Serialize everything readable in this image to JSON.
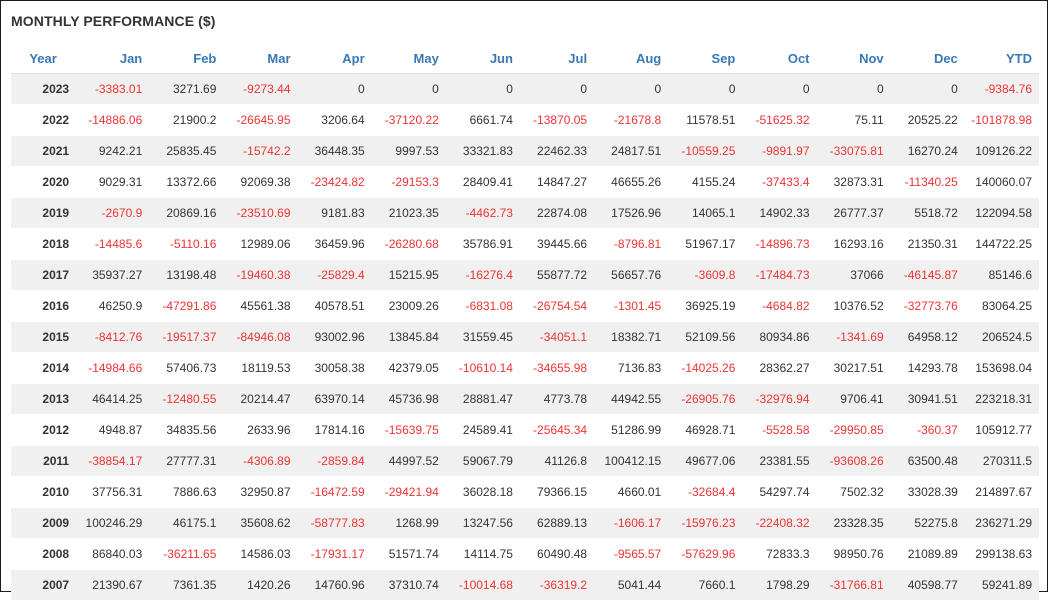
{
  "title": "MONTHLY PERFORMANCE ($)",
  "colors": {
    "header_text": "#3a78b5",
    "negative": "#ee3333",
    "positive": "#333333",
    "stripe": "#f0f0f0"
  },
  "table": {
    "columns": [
      "Year",
      "Jan",
      "Feb",
      "Mar",
      "Apr",
      "May",
      "Jun",
      "Jul",
      "Aug",
      "Sep",
      "Oct",
      "Nov",
      "Dec",
      "YTD"
    ],
    "rows": [
      [
        "2023",
        "-3383.01",
        "3271.69",
        "-9273.44",
        "0",
        "0",
        "0",
        "0",
        "0",
        "0",
        "0",
        "0",
        "0",
        "-9384.76"
      ],
      [
        "2022",
        "-14886.06",
        "21900.2",
        "-26645.95",
        "3206.64",
        "-37120.22",
        "6661.74",
        "-13870.05",
        "-21678.8",
        "11578.51",
        "-51625.32",
        "75.11",
        "20525.22",
        "-101878.98"
      ],
      [
        "2021",
        "9242.21",
        "25835.45",
        "-15742.2",
        "36448.35",
        "9997.53",
        "33321.83",
        "22462.33",
        "24817.51",
        "-10559.25",
        "-9891.97",
        "-33075.81",
        "16270.24",
        "109126.22"
      ],
      [
        "2020",
        "9029.31",
        "13372.66",
        "92069.38",
        "-23424.82",
        "-29153.3",
        "28409.41",
        "14847.27",
        "46655.26",
        "4155.24",
        "-37433.4",
        "32873.31",
        "-11340.25",
        "140060.07"
      ],
      [
        "2019",
        "-2670.9",
        "20869.16",
        "-23510.69",
        "9181.83",
        "21023.35",
        "-4462.73",
        "22874.08",
        "17526.96",
        "14065.1",
        "14902.33",
        "26777.37",
        "5518.72",
        "122094.58"
      ],
      [
        "2018",
        "-14485.6",
        "-5110.16",
        "12989.06",
        "36459.96",
        "-26280.68",
        "35786.91",
        "39445.66",
        "-8796.81",
        "51967.17",
        "-14896.73",
        "16293.16",
        "21350.31",
        "144722.25"
      ],
      [
        "2017",
        "35937.27",
        "13198.48",
        "-19460.38",
        "-25829.4",
        "15215.95",
        "-16276.4",
        "55877.72",
        "56657.76",
        "-3609.8",
        "-17484.73",
        "37066",
        "-46145.87",
        "85146.6"
      ],
      [
        "2016",
        "46250.9",
        "-47291.86",
        "45561.38",
        "40578.51",
        "23009.26",
        "-6831.08",
        "-26754.54",
        "-1301.45",
        "36925.19",
        "-4684.82",
        "10376.52",
        "-32773.76",
        "83064.25"
      ],
      [
        "2015",
        "-8412.76",
        "-19517.37",
        "-84946.08",
        "93002.96",
        "13845.84",
        "31559.45",
        "-34051.1",
        "18382.71",
        "52109.56",
        "80934.86",
        "-1341.69",
        "64958.12",
        "206524.5"
      ],
      [
        "2014",
        "-14984.66",
        "57406.73",
        "18119.53",
        "30058.38",
        "42379.05",
        "-10610.14",
        "-34655.98",
        "7136.83",
        "-14025.26",
        "28362.27",
        "30217.51",
        "14293.78",
        "153698.04"
      ],
      [
        "2013",
        "46414.25",
        "-12480.55",
        "20214.47",
        "63970.14",
        "45736.98",
        "28881.47",
        "4773.78",
        "44942.55",
        "-26905.76",
        "-32976.94",
        "9706.41",
        "30941.51",
        "223218.31"
      ],
      [
        "2012",
        "4948.87",
        "34835.56",
        "2633.96",
        "17814.16",
        "-15639.75",
        "24589.41",
        "-25645.34",
        "51286.99",
        "46928.71",
        "-5528.58",
        "-29950.85",
        "-360.37",
        "105912.77"
      ],
      [
        "2011",
        "-38854.17",
        "27777.31",
        "-4306.89",
        "-2859.84",
        "44997.52",
        "59067.79",
        "41126.8",
        "100412.15",
        "49677.06",
        "23381.55",
        "-93608.26",
        "63500.48",
        "270311.5"
      ],
      [
        "2010",
        "37756.31",
        "7886.63",
        "32950.87",
        "-16472.59",
        "-29421.94",
        "36028.18",
        "79366.15",
        "4660.01",
        "-32684.4",
        "54297.74",
        "7502.32",
        "33028.39",
        "214897.67"
      ],
      [
        "2009",
        "100246.29",
        "46175.1",
        "35608.62",
        "-58777.83",
        "1268.99",
        "13247.56",
        "62889.13",
        "-1606.17",
        "-15976.23",
        "-22408.32",
        "23328.35",
        "52275.8",
        "236271.29"
      ],
      [
        "2008",
        "86840.03",
        "-36211.65",
        "14586.03",
        "-17931.17",
        "51571.74",
        "14114.75",
        "60490.48",
        "-9565.57",
        "-57629.96",
        "72833.3",
        "98950.76",
        "21089.89",
        "299138.63"
      ],
      [
        "2007",
        "21390.67",
        "7361.35",
        "1420.26",
        "14760.96",
        "37310.74",
        "-10014.68",
        "-36319.2",
        "5041.44",
        "7660.1",
        "1798.29",
        "-31766.81",
        "40598.77",
        "59241.89"
      ]
    ]
  }
}
